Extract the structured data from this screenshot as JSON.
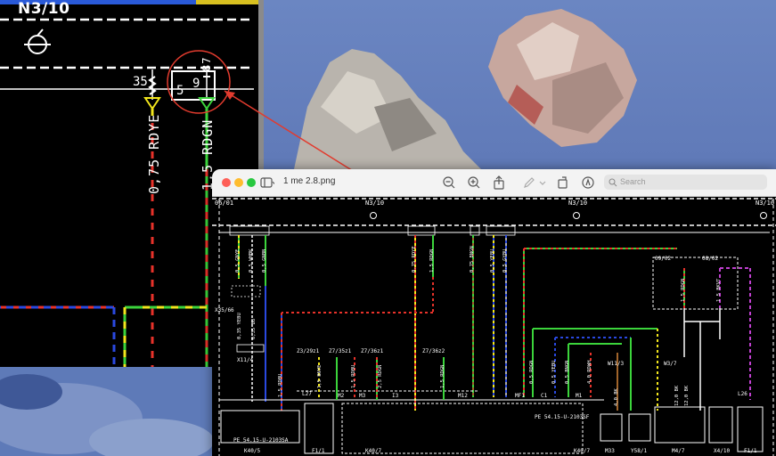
{
  "zoom_view": {
    "title": "N3/10",
    "pin_35": "35",
    "pin_87": "87",
    "pin_5": "5",
    "pin_9": "9",
    "wire_left": "0,75 RDYE",
    "wire_right": "1,5 RDGN"
  },
  "preview_window": {
    "filename": "1 me 2.8.png",
    "search_placeholder": "Search",
    "schematic": {
      "top_ref": "06/01",
      "module_labels": [
        "N3/10",
        "N3/10",
        "N3/10"
      ],
      "wire_labels": [
        "0,5 GNYE",
        "0,5 WHBK",
        "0,5 GNBN",
        "0,75 RDYE",
        "1,5 RDGN",
        "0,75 BNGN",
        "0,5 YEBU",
        "0,5 GYBU",
        "1,5 RDGN",
        "1 5 BKVT",
        "0,35 YEBU",
        "0,35 BU",
        "1,5 RDBU",
        "1,5 BNYE",
        "1,5 RDBU",
        "2,5 RDGN",
        "1,5 RDGN",
        "0,5 RDGN",
        "0,5 YEBU",
        "0,5 BNGN",
        "4,0 RDWH",
        "4,0 BK",
        "12,0 BK",
        "12,0 BK"
      ],
      "connectors": [
        "X35/66",
        "X11/4",
        "Z3/29z1",
        "Z7/35z1",
        "Z7/36z1",
        "Z7/36z2",
        "09/02",
        "08/02",
        "W11/3",
        "W3/7",
        "L27",
        "L26"
      ],
      "relays": [
        "M2",
        "M3",
        "I3",
        "M12",
        "MF1",
        "C1",
        "M1"
      ],
      "bottom_refs": [
        "K40/5",
        "F1/1",
        "K40/7",
        "K40/7",
        "M33",
        "Y58/1",
        "M4/7",
        "X4/10",
        "F1/1"
      ],
      "ref_left": "PE 54.15-U-2103SA",
      "ref_right": "PE 54.15-U-2103SF"
    }
  },
  "colors": {
    "red": "#e8322a",
    "green": "#3bd43b",
    "yellow": "#f2e61c",
    "blue": "#2a49e0",
    "brown": "#a0642a",
    "violet": "#c040d0",
    "annotation": "#e23b2e"
  }
}
